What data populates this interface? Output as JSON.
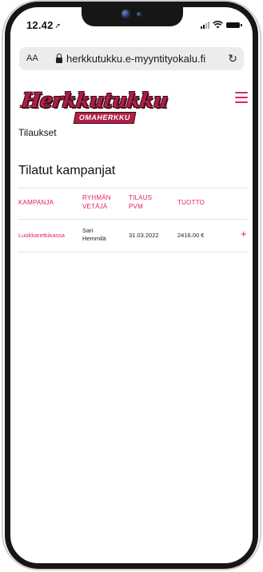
{
  "status_bar": {
    "time": "12.42",
    "location_arrow": "➚"
  },
  "browser": {
    "text_size_label": "AA",
    "url": "herkkutukku.e-myyntityokalu.fi",
    "reload_icon": "↻"
  },
  "site": {
    "logo_main": "Herkkutukku",
    "logo_sub": "OMAHERKKU",
    "section_title": "Tilaukset",
    "heading": "Tilatut kampanjat"
  },
  "table": {
    "headers": [
      "KAMPANJA",
      "RYHMÄN\nVETÄJÄ",
      "TILAUS\nPVM",
      "TUOTTO"
    ],
    "rows": [
      {
        "campaign": "Luokkaretkikassa",
        "leader": "Sari Hemmilä",
        "date": "31.03.2022",
        "revenue": "2416.00 €",
        "action": "+"
      }
    ]
  },
  "colors": {
    "accent": "#e0245e",
    "logo": "#b01f45"
  }
}
